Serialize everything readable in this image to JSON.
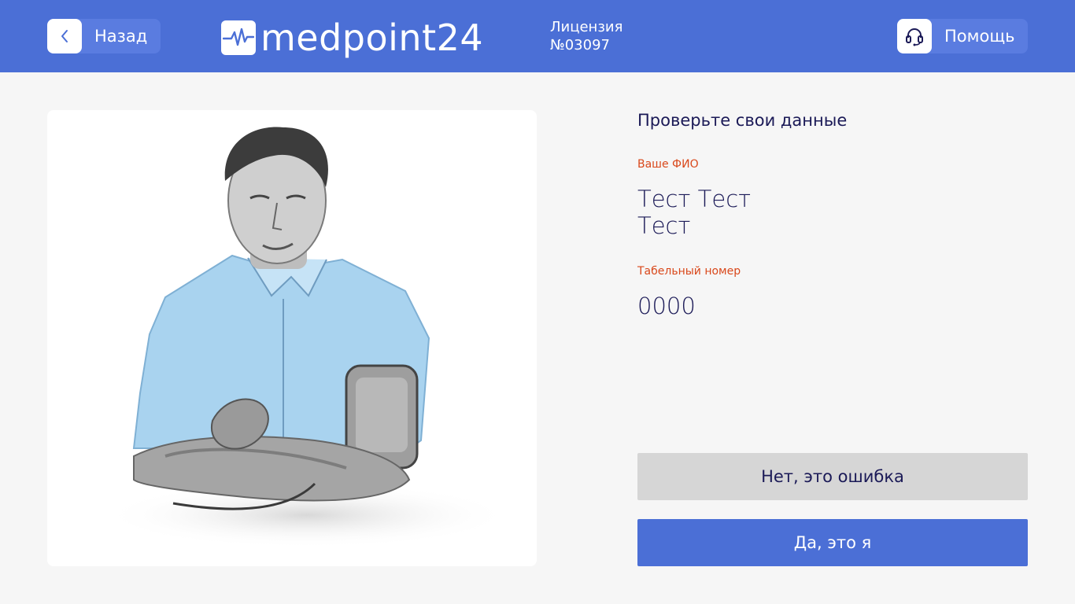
{
  "colors": {
    "header_bg": "#4b6fd6",
    "button_tint": "#5a7ce0",
    "page_bg": "#f6f6f6",
    "title_text": "#1b1a57",
    "label_accent": "#d9481b",
    "secondary_button": "#d6d6d6",
    "primary_button": "#4b6fd6"
  },
  "header": {
    "back_label": "Назад",
    "back_icon": "chevron-left-icon",
    "logo_text": "medpoint24",
    "logo_icon": "heartbeat-icon",
    "license_line1": "Лицензия",
    "license_line2": "№03097",
    "help_label": "Помощь",
    "help_icon": "headset-icon"
  },
  "photo": {
    "subject": "man-measuring-blood-pressure-illustration"
  },
  "details": {
    "title": "Проверьте свои данные",
    "name_label": "Ваше ФИО",
    "name_line1": "Тест Тест",
    "name_line2": "Тест",
    "id_label": "Табельный номер",
    "id_value": "0000"
  },
  "actions": {
    "reject_label": "Нет, это ошибка",
    "confirm_label": "Да, это я"
  }
}
